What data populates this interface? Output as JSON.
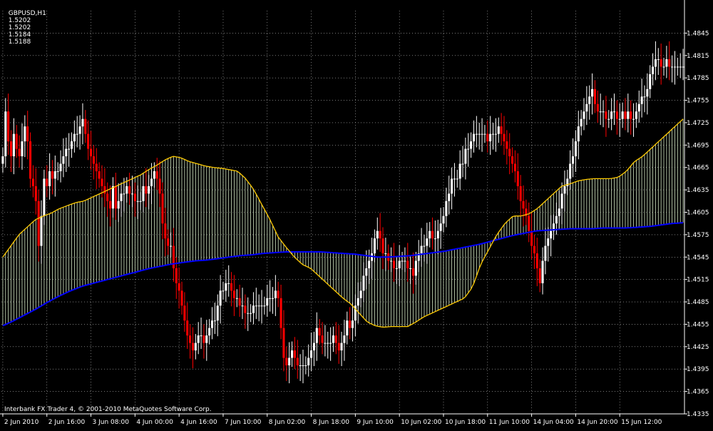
{
  "header": {
    "symbol": "GBPUSD,H1",
    "values": [
      "1.5202",
      "1.5202",
      "1.5184",
      "1.5188"
    ]
  },
  "copyright": "Interbank FX Trader 4, © 2001-2010 MetaQuotes Software Corp.",
  "colors": {
    "background": "#000000",
    "grid": "#c0c0c0",
    "bull_candle": "#ffffff",
    "bear_candle": "#ff0000",
    "fast_ma": "#ffcc00",
    "slow_ma": "#0000ff",
    "histogram_fill": "#d8ecc8"
  },
  "chart_data": {
    "type": "line",
    "subtype": "candlestick",
    "ylim": [
      1.4335,
      1.4875
    ],
    "grid": true,
    "y_ticks": [
      "1.4845",
      "1.4815",
      "1.4785",
      "1.4755",
      "1.4725",
      "1.4695",
      "1.4665",
      "1.4635",
      "1.4605",
      "1.4575",
      "1.4545",
      "1.4515",
      "1.4485",
      "1.4455",
      "1.4425",
      "1.4395",
      "1.4365",
      "1.4335"
    ],
    "x_ticks": [
      "2 Jun 2010",
      "2 Jun 16:00",
      "3 Jun 08:00",
      "4 Jun 00:00",
      "4 Jun 16:00",
      "7 Jun 10:00",
      "8 Jun 02:00",
      "8 Jun 18:00",
      "9 Jun 10:00",
      "10 Jun 02:00",
      "10 Jun 18:00",
      "11 Jun 10:00",
      "14 Jun 04:00",
      "14 Jun 20:00",
      "15 Jun 12:00"
    ],
    "x_tick_index": [
      0,
      16,
      32,
      48,
      64,
      80,
      96,
      112,
      128,
      144,
      160,
      176,
      192,
      208,
      224
    ],
    "close": [
      1.468,
      1.474,
      1.47,
      1.468,
      1.471,
      1.469,
      1.468,
      1.47,
      1.472,
      1.47,
      1.465,
      1.464,
      1.462,
      1.456,
      1.46,
      1.465,
      1.464,
      1.466,
      1.465,
      1.466,
      1.466,
      1.467,
      1.468,
      1.469,
      1.469,
      1.47,
      1.471,
      1.471,
      1.472,
      1.473,
      1.471,
      1.469,
      1.468,
      1.467,
      1.466,
      1.465,
      1.464,
      1.463,
      1.462,
      1.461,
      1.464,
      1.461,
      1.462,
      1.463,
      1.463,
      1.464,
      1.463,
      1.463,
      1.462,
      1.462,
      1.462,
      1.464,
      1.463,
      1.464,
      1.465,
      1.466,
      1.465,
      1.463,
      1.459,
      1.457,
      1.456,
      1.456,
      1.453,
      1.451,
      1.45,
      1.448,
      1.446,
      1.444,
      1.443,
      1.442,
      1.443,
      1.444,
      1.444,
      1.443,
      1.444,
      1.445,
      1.446,
      1.446,
      1.448,
      1.45,
      1.45,
      1.451,
      1.451,
      1.45,
      1.449,
      1.449,
      1.448,
      1.448,
      1.447,
      1.447,
      1.447,
      1.448,
      1.448,
      1.448,
      1.448,
      1.448,
      1.449,
      1.449,
      1.449,
      1.45,
      1.449,
      1.445,
      1.441,
      1.44,
      1.441,
      1.442,
      1.441,
      1.44,
      1.44,
      1.44,
      1.44,
      1.441,
      1.442,
      1.443,
      1.445,
      1.444,
      1.443,
      1.443,
      1.443,
      1.443,
      1.444,
      1.443,
      1.442,
      1.443,
      1.444,
      1.446,
      1.445,
      1.446,
      1.448,
      1.449,
      1.45,
      1.452,
      1.453,
      1.454,
      1.455,
      1.457,
      1.458,
      1.457,
      1.455,
      1.455,
      1.454,
      1.454,
      1.453,
      1.453,
      1.454,
      1.454,
      1.454,
      1.453,
      1.453,
      1.452,
      1.454,
      1.455,
      1.456,
      1.456,
      1.457,
      1.458,
      1.457,
      1.457,
      1.458,
      1.459,
      1.46,
      1.462,
      1.463,
      1.465,
      1.465,
      1.465,
      1.467,
      1.467,
      1.469,
      1.469,
      1.47,
      1.471,
      1.471,
      1.471,
      1.471,
      1.471,
      1.47,
      1.471,
      1.471,
      1.471,
      1.472,
      1.471,
      1.47,
      1.469,
      1.468,
      1.467,
      1.466,
      1.464,
      1.462,
      1.461,
      1.46,
      1.458,
      1.456,
      1.455,
      1.453,
      1.451,
      1.454,
      1.456,
      1.457,
      1.458,
      1.459,
      1.46,
      1.461,
      1.463,
      1.464,
      1.465,
      1.467,
      1.468,
      1.47,
      1.472,
      1.473,
      1.474,
      1.475,
      1.476,
      1.477,
      1.475,
      1.474,
      1.474,
      1.474,
      1.473,
      1.473,
      1.474,
      1.474,
      1.473,
      1.473,
      1.474,
      1.473,
      1.474,
      1.473,
      1.473,
      1.474,
      1.475,
      1.476,
      1.476,
      1.477,
      1.479,
      1.48,
      1.481,
      1.481,
      1.48,
      1.48,
      1.481,
      1.48,
      1.48,
      1.48,
      1.48,
      1.48,
      1.48
    ],
    "series": [
      {
        "values": [
          1.4545,
          1.456,
          1.4575,
          1.4585,
          1.4595,
          1.46,
          1.4604,
          1.461,
          1.4614,
          1.4618,
          1.462,
          1.4625,
          1.463,
          1.4635,
          1.464,
          1.4645,
          1.465,
          1.4655,
          1.4662,
          1.4668,
          1.4675,
          1.468,
          1.4678,
          1.4673,
          1.467,
          1.4667,
          1.4665,
          1.4664,
          1.4662,
          1.466,
          1.465,
          1.4635,
          1.4615,
          1.4595,
          1.4572,
          1.4558,
          1.4545,
          1.4535,
          1.453,
          1.452,
          1.451,
          1.45,
          1.449,
          1.4482,
          1.447,
          1.4458,
          1.4453,
          1.4451,
          1.4452,
          1.4452,
          1.4452,
          1.4458,
          1.4465,
          1.447,
          1.4475,
          1.448,
          1.4485,
          1.449,
          1.4505,
          1.4535,
          1.4555,
          1.4575,
          1.459,
          1.46,
          1.46,
          1.4603,
          1.461,
          1.462,
          1.463,
          1.464,
          1.4643,
          1.4647,
          1.4649,
          1.465,
          1.465,
          1.465,
          1.4652,
          1.466,
          1.4673,
          1.468,
          1.469,
          1.47,
          1.471,
          1.472,
          1.473
        ]
      },
      {
        "values": [
          1.4453,
          1.446,
          1.4468,
          1.4476,
          1.4485,
          1.4493,
          1.45,
          1.4506,
          1.451,
          1.4514,
          1.4518,
          1.4522,
          1.4526,
          1.453,
          1.4533,
          1.4536,
          1.4538,
          1.454,
          1.4541,
          1.4543,
          1.4545,
          1.4547,
          1.4548,
          1.455,
          1.4551,
          1.4552,
          1.4552,
          1.4552,
          1.4552,
          1.4551,
          1.455,
          1.4549,
          1.4547,
          1.4545,
          1.4545,
          1.4546,
          1.4547,
          1.4549,
          1.4551,
          1.4553,
          1.4556,
          1.4559,
          1.4562,
          1.4566,
          1.457,
          1.4574,
          1.4577,
          1.458,
          1.4581,
          1.4582,
          1.4583,
          1.4583,
          1.4583,
          1.4584,
          1.4584,
          1.4584,
          1.4585,
          1.4586,
          1.4588,
          1.459,
          1.4591
        ]
      }
    ]
  }
}
